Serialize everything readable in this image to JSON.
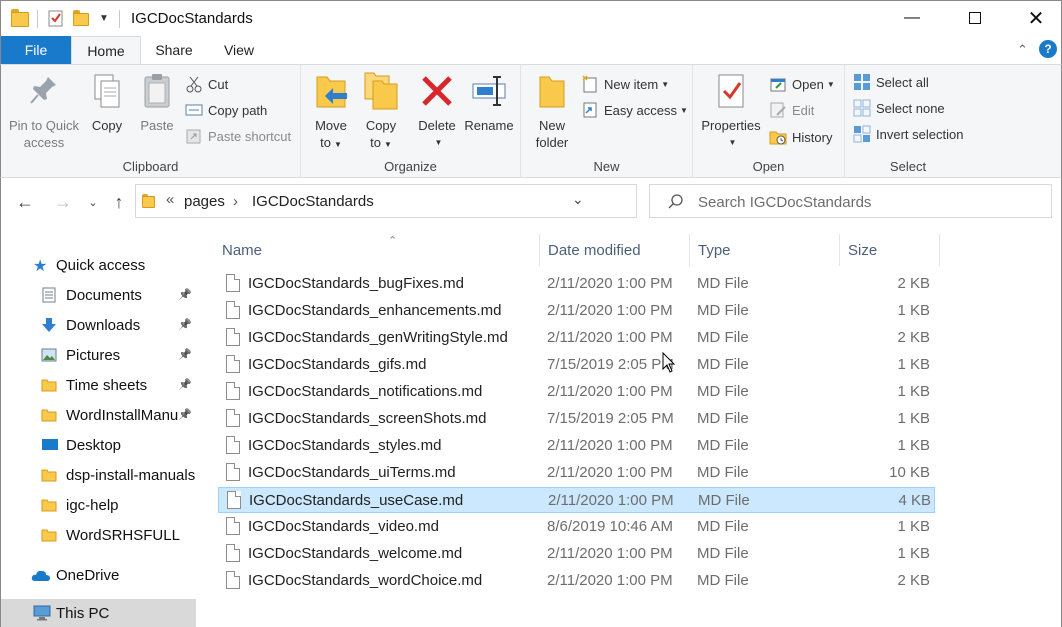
{
  "window": {
    "title": "IGCDocStandards"
  },
  "ribbon_tabs": {
    "file": "File",
    "home": "Home",
    "share": "Share",
    "view": "View"
  },
  "clipboard": {
    "pin_line1": "Pin to Quick",
    "pin_line2": "access",
    "copy": "Copy",
    "paste": "Paste",
    "cut": "Cut",
    "copy_path": "Copy path",
    "paste_shortcut": "Paste shortcut",
    "label": "Clipboard"
  },
  "organize": {
    "move_line1": "Move",
    "move_line2": "to",
    "copy_line1": "Copy",
    "copy_line2": "to",
    "delete": "Delete",
    "rename": "Rename",
    "label": "Organize"
  },
  "new_group": {
    "new_folder_line1": "New",
    "new_folder_line2": "folder",
    "new_item": "New item",
    "easy_access": "Easy access",
    "label": "New"
  },
  "open_group": {
    "properties": "Properties",
    "open": "Open",
    "edit": "Edit",
    "history": "History",
    "label": "Open"
  },
  "select_group": {
    "select_all": "Select all",
    "select_none": "Select none",
    "invert": "Invert selection",
    "label": "Select"
  },
  "address": {
    "chevrons": "«",
    "crumb1": "pages",
    "separator": "›",
    "crumb2": "IGCDocStandards"
  },
  "search": {
    "placeholder": "Search IGCDocStandards"
  },
  "nav": {
    "quick_access": "Quick access",
    "items": [
      {
        "label": "Documents",
        "icon": "documents-icon",
        "pinned": true
      },
      {
        "label": "Downloads",
        "icon": "downloads-icon",
        "pinned": true
      },
      {
        "label": "Pictures",
        "icon": "pictures-icon",
        "pinned": true
      },
      {
        "label": "Time sheets",
        "icon": "folder-icon",
        "pinned": true
      },
      {
        "label": "WordInstallManu",
        "icon": "folder-icon",
        "pinned": true
      },
      {
        "label": "Desktop",
        "icon": "desktop-icon",
        "pinned": false
      },
      {
        "label": "dsp-install-manuals",
        "icon": "folder-icon",
        "pinned": false
      },
      {
        "label": "igc-help",
        "icon": "folder-icon",
        "pinned": false
      },
      {
        "label": "WordSRHSFULL",
        "icon": "folder-icon",
        "pinned": false
      }
    ],
    "onedrive": "OneDrive",
    "this_pc": "This PC"
  },
  "columns": {
    "name": "Name",
    "date": "Date modified",
    "type": "Type",
    "size": "Size"
  },
  "files": [
    {
      "name": "IGCDocStandards_bugFixes.md",
      "date": "2/11/2020 1:00 PM",
      "type": "MD File",
      "size": "2 KB"
    },
    {
      "name": "IGCDocStandards_enhancements.md",
      "date": "2/11/2020 1:00 PM",
      "type": "MD File",
      "size": "1 KB"
    },
    {
      "name": "IGCDocStandards_genWritingStyle.md",
      "date": "2/11/2020 1:00 PM",
      "type": "MD File",
      "size": "2 KB"
    },
    {
      "name": "IGCDocStandards_gifs.md",
      "date": "7/15/2019 2:05 PM",
      "type": "MD File",
      "size": "1 KB"
    },
    {
      "name": "IGCDocStandards_notifications.md",
      "date": "2/11/2020 1:00 PM",
      "type": "MD File",
      "size": "1 KB"
    },
    {
      "name": "IGCDocStandards_screenShots.md",
      "date": "7/15/2019 2:05 PM",
      "type": "MD File",
      "size": "1 KB"
    },
    {
      "name": "IGCDocStandards_styles.md",
      "date": "2/11/2020 1:00 PM",
      "type": "MD File",
      "size": "1 KB"
    },
    {
      "name": "IGCDocStandards_uiTerms.md",
      "date": "2/11/2020 1:00 PM",
      "type": "MD File",
      "size": "10 KB"
    },
    {
      "name": "IGCDocStandards_useCase.md",
      "date": "2/11/2020 1:00 PM",
      "type": "MD File",
      "size": "4 KB",
      "selected": true
    },
    {
      "name": "IGCDocStandards_video.md",
      "date": "8/6/2019 10:46 AM",
      "type": "MD File",
      "size": "1 KB"
    },
    {
      "name": "IGCDocStandards_welcome.md",
      "date": "2/11/2020 1:00 PM",
      "type": "MD File",
      "size": "1 KB"
    },
    {
      "name": "IGCDocStandards_wordChoice.md",
      "date": "2/11/2020 1:00 PM",
      "type": "MD File",
      "size": "2 KB"
    }
  ],
  "colors": {
    "accent": "#1979ca",
    "selection": "#cce8ff",
    "folder": "#f8c94a"
  }
}
